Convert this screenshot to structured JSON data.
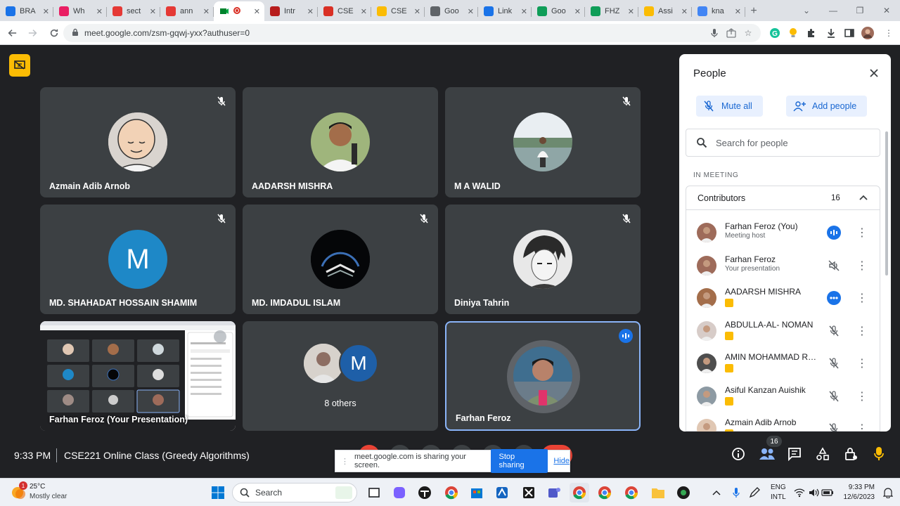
{
  "browser": {
    "tabs": [
      {
        "title": "BRA",
        "color": "#1a73e8"
      },
      {
        "title": "Wh",
        "color": "#e91e63"
      },
      {
        "title": "sect",
        "color": "#e53935"
      },
      {
        "title": "ann",
        "color": "#e53935"
      },
      {
        "title": "",
        "color": "#34a853",
        "active": true
      },
      {
        "title": "Intr",
        "color": "#b71c1c"
      },
      {
        "title": "CSE",
        "color": "#d93025"
      },
      {
        "title": "CSE",
        "color": "#fbbc04"
      },
      {
        "title": "Goo",
        "color": "#5f6368"
      },
      {
        "title": "Link",
        "color": "#1a73e8"
      },
      {
        "title": "Goo",
        "color": "#0f9d58"
      },
      {
        "title": "FHZ",
        "color": "#0f9d58"
      },
      {
        "title": "Assi",
        "color": "#fbbc04"
      },
      {
        "title": "kna",
        "color": "#4285f4"
      }
    ],
    "url": "meet.google.com/zsm-gqwj-yxx?authuser=0"
  },
  "meeting": {
    "tiles": [
      {
        "name": "Azmain Adib Arnob",
        "muted": true
      },
      {
        "name": "AADARSH MISHRA",
        "muted": false
      },
      {
        "name": "M A WALID",
        "muted": true
      },
      {
        "name": "MD. SHAHADAT HOSSAIN SHAMIM",
        "muted": true,
        "initial": "M"
      },
      {
        "name": "MD. IMDADUL ISLAM",
        "muted": true
      },
      {
        "name": "Diniya Tahrin",
        "muted": true
      },
      {
        "name": "Farhan Feroz (Your Presentation)",
        "muted": false
      },
      {
        "name": "8 others",
        "muted": false,
        "initial": "M"
      },
      {
        "name": "Farhan Feroz",
        "muted": false,
        "speaking": true
      }
    ],
    "time": "9:33 PM",
    "title": "CSE221 Online Class (Greedy Algorithms)",
    "people_badge": "16"
  },
  "people_panel": {
    "title": "People",
    "mute_all": "Mute all",
    "add_people": "Add people",
    "search_placeholder": "Search for people",
    "section": "IN MEETING",
    "group": "Contributors",
    "count": "16",
    "participants": [
      {
        "name": "Farhan Feroz (You)",
        "sub": "Meeting host",
        "state": "speaking"
      },
      {
        "name": "Farhan Feroz",
        "sub": "Your presentation",
        "state": "presenting"
      },
      {
        "name": "AADARSH MISHRA",
        "sub": "",
        "state": "dots"
      },
      {
        "name": "ABDULLA-AL- NOMAN",
        "sub": "",
        "state": "muted"
      },
      {
        "name": "AMIN MOHAMMAD RO...",
        "sub": "",
        "state": "muted"
      },
      {
        "name": "Asiful Kanzan Auishik",
        "sub": "",
        "state": "muted"
      },
      {
        "name": "Azmain Adib Arnob",
        "sub": "",
        "state": "muted"
      }
    ]
  },
  "share_banner": {
    "text": "meet.google.com is sharing your screen.",
    "stop": "Stop sharing",
    "hide": "Hide"
  },
  "taskbar": {
    "weather_temp": "25°C",
    "weather_desc": "Mostly clear",
    "weather_badge": "1",
    "search": "Search",
    "lang": "ENG",
    "layout": "INTL",
    "clock_time": "9:33 PM",
    "clock_date": "12/6/2023"
  }
}
